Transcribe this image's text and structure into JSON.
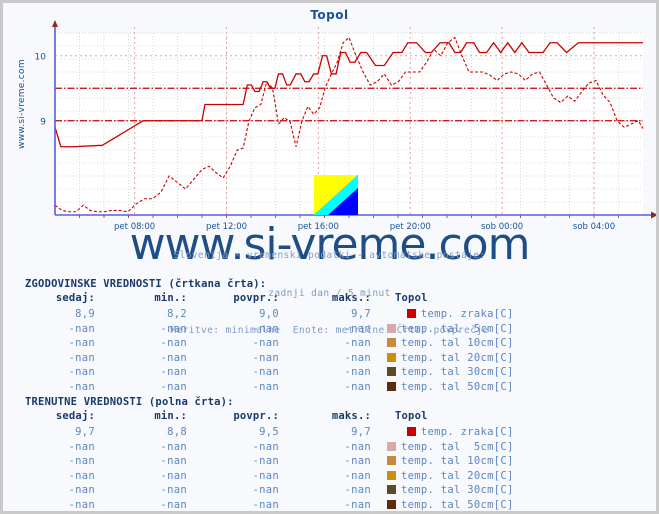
{
  "page": {
    "background": "#f7f9fd",
    "border_color": "#c9c9c9"
  },
  "chart": {
    "title": "Topol",
    "y_axis_caption": "www.si-vreme.com",
    "watermark": "www.si-vreme.com",
    "caption_line1": "Slovenija - vremenski podatki - avtomatske postaje:",
    "caption_line2": "zadnji dan / 5 minut",
    "caption_line3": "Meritve: minimalne  Enote: metrične  Črta: povprečje",
    "accent_color": "#cc0000",
    "label_color": "#1a5296",
    "axis_color": "#5b5be0",
    "grid_color": "#d9d9d9",
    "grid_accent_color": "#e8a0a0"
  },
  "chart_data": {
    "type": "line",
    "title": "Topol",
    "xlabel": "",
    "ylabel": "temp. zraka[C]",
    "ylim": [
      7.55,
      10.35
    ],
    "yticks": [
      9,
      10
    ],
    "ytick_labels": [
      "9",
      "10"
    ],
    "grid": true,
    "legend_position": "below-table",
    "xticks": [
      "pet 08:00",
      "pet 12:00",
      "pet 16:00",
      "pet 20:00",
      "sob 00:00",
      "sob 04:00"
    ],
    "xtick_positions": [
      0.1354,
      0.2917,
      0.4479,
      0.6042,
      0.7604,
      0.9167
    ],
    "x_range_hours": 25.6,
    "reference_lines": [
      {
        "name": "avg-current",
        "value": 9.5,
        "style": "dash-dot",
        "color": "#cc0000"
      },
      {
        "name": "avg-history",
        "value": 9.0,
        "style": "dash-dot",
        "color": "#cc0000"
      }
    ],
    "series": [
      {
        "name": "temp. zraka[C] - trenutne (polna črta)",
        "style": "solid",
        "color": "#cc0000",
        "x": [
          0.0,
          0.01,
          0.018,
          0.03,
          0.075,
          0.08,
          0.15,
          0.155,
          0.25,
          0.255,
          0.32,
          0.327,
          0.334,
          0.34,
          0.347,
          0.354,
          0.36,
          0.367,
          0.374,
          0.38,
          0.387,
          0.394,
          0.4,
          0.41,
          0.418,
          0.425,
          0.432,
          0.44,
          0.447,
          0.455,
          0.462,
          0.47,
          0.478,
          0.486,
          0.494,
          0.502,
          0.51,
          0.52,
          0.53,
          0.545,
          0.56,
          0.575,
          0.59,
          0.6,
          0.615,
          0.63,
          0.64,
          0.655,
          0.67,
          0.68,
          0.69,
          0.7,
          0.712,
          0.722,
          0.734,
          0.746,
          0.758,
          0.77,
          0.782,
          0.794,
          0.806,
          0.818,
          0.83,
          0.842,
          0.854,
          0.87,
          0.89,
          0.92,
          0.96,
          1.0
        ],
        "y": [
          8.9,
          8.6,
          8.6,
          8.6,
          8.62,
          8.62,
          9.0,
          9.0,
          9.0,
          9.25,
          9.25,
          9.55,
          9.55,
          9.45,
          9.45,
          9.6,
          9.6,
          9.5,
          9.5,
          9.72,
          9.72,
          9.55,
          9.55,
          9.72,
          9.72,
          9.6,
          9.6,
          9.72,
          9.72,
          10.0,
          10.0,
          9.72,
          9.72,
          10.05,
          10.05,
          9.9,
          9.9,
          10.05,
          10.05,
          9.85,
          9.85,
          10.05,
          10.05,
          10.2,
          10.2,
          10.05,
          10.05,
          10.2,
          10.2,
          10.05,
          10.05,
          10.2,
          10.2,
          10.05,
          10.05,
          10.2,
          10.05,
          10.2,
          10.05,
          10.2,
          10.05,
          10.05,
          10.05,
          10.2,
          10.2,
          10.05,
          10.2,
          10.2,
          10.2,
          10.2
        ]
      },
      {
        "name": "temp. zraka[C] - zgodovinske (črtkana črta)",
        "style": "dashed",
        "color": "#cc0000",
        "x": [
          0.0,
          0.012,
          0.024,
          0.036,
          0.048,
          0.06,
          0.072,
          0.084,
          0.096,
          0.11,
          0.124,
          0.138,
          0.152,
          0.166,
          0.18,
          0.194,
          0.208,
          0.222,
          0.236,
          0.25,
          0.262,
          0.274,
          0.286,
          0.298,
          0.31,
          0.32,
          0.33,
          0.34,
          0.35,
          0.36,
          0.37,
          0.38,
          0.39,
          0.4,
          0.41,
          0.42,
          0.43,
          0.44,
          0.45,
          0.46,
          0.47,
          0.48,
          0.49,
          0.5,
          0.512,
          0.524,
          0.536,
          0.548,
          0.56,
          0.572,
          0.584,
          0.596,
          0.608,
          0.62,
          0.632,
          0.644,
          0.656,
          0.668,
          0.68,
          0.692,
          0.704,
          0.716,
          0.728,
          0.74,
          0.752,
          0.764,
          0.776,
          0.788,
          0.8,
          0.812,
          0.824,
          0.836,
          0.848,
          0.86,
          0.872,
          0.884,
          0.896,
          0.908,
          0.92,
          0.932,
          0.944,
          0.956,
          0.968,
          0.98,
          0.992,
          1.0
        ],
        "y": [
          7.7,
          7.62,
          7.6,
          7.6,
          7.7,
          7.62,
          7.6,
          7.6,
          7.62,
          7.62,
          7.6,
          7.72,
          7.8,
          7.8,
          7.9,
          8.15,
          8.05,
          7.95,
          8.1,
          8.25,
          8.3,
          8.2,
          8.12,
          8.3,
          8.55,
          8.58,
          9.0,
          9.2,
          9.25,
          9.6,
          9.5,
          8.95,
          9.05,
          8.98,
          8.6,
          9.0,
          9.22,
          9.1,
          9.2,
          9.52,
          9.72,
          9.9,
          10.2,
          10.28,
          10.0,
          9.75,
          9.55,
          9.6,
          9.72,
          9.55,
          9.6,
          9.75,
          9.75,
          9.75,
          9.9,
          10.1,
          10.0,
          10.2,
          10.28,
          10.0,
          9.75,
          9.75,
          9.75,
          9.7,
          9.62,
          9.72,
          9.75,
          9.72,
          9.62,
          9.72,
          9.75,
          9.55,
          9.35,
          9.28,
          9.38,
          9.3,
          9.45,
          9.58,
          9.62,
          9.4,
          9.28,
          9.0,
          8.9,
          8.95,
          9.0,
          8.88
        ]
      }
    ]
  },
  "flag_logo": {
    "name": "si-vreme-flag-logo",
    "colors": [
      "#ffff00",
      "#00ffff",
      "#0000ff"
    ]
  },
  "tables": [
    {
      "id": "hist",
      "title": "ZGODOVINSKE VREDNOSTI (črtkana črta):",
      "headers": [
        "sedaj:",
        "min.:",
        "povpr.:",
        "maks.:",
        "Topol"
      ],
      "rows": [
        {
          "sedaj": "8,9",
          "min": "8,2",
          "povpr": "9,0",
          "maks": "9,7",
          "label": "temp. zraka[C]",
          "color": "#cc0000",
          "swatch_style": "dashed"
        },
        {
          "sedaj": "-nan",
          "min": "-nan",
          "povpr": "-nan",
          "maks": "-nan",
          "label": "temp. tal  5cm[C]",
          "color": "#d8a9a9",
          "swatch_style": "dashed"
        },
        {
          "sedaj": "-nan",
          "min": "-nan",
          "povpr": "-nan",
          "maks": "-nan",
          "label": "temp. tal 10cm[C]",
          "color": "#c88a3c",
          "swatch_style": "dashed"
        },
        {
          "sedaj": "-nan",
          "min": "-nan",
          "povpr": "-nan",
          "maks": "-nan",
          "label": "temp. tal 20cm[C]",
          "color": "#c8900c",
          "swatch_style": "dashed"
        },
        {
          "sedaj": "-nan",
          "min": "-nan",
          "povpr": "-nan",
          "maks": "-nan",
          "label": "temp. tal 30cm[C]",
          "color": "#5b4b28",
          "swatch_style": "dashed"
        },
        {
          "sedaj": "-nan",
          "min": "-nan",
          "povpr": "-nan",
          "maks": "-nan",
          "label": "temp. tal 50cm[C]",
          "color": "#5c2d0c",
          "swatch_style": "dashed"
        }
      ]
    },
    {
      "id": "curr",
      "title": "TRENUTNE VREDNOSTI (polna črta):",
      "headers": [
        "sedaj:",
        "min.:",
        "povpr.:",
        "maks.:",
        "Topol"
      ],
      "rows": [
        {
          "sedaj": "9,7",
          "min": "8,8",
          "povpr": "9,5",
          "maks": "9,7",
          "label": "temp. zraka[C]",
          "color": "#cc0000",
          "swatch_style": "solid"
        },
        {
          "sedaj": "-nan",
          "min": "-nan",
          "povpr": "-nan",
          "maks": "-nan",
          "label": "temp. tal  5cm[C]",
          "color": "#d8a9a9",
          "swatch_style": "solid"
        },
        {
          "sedaj": "-nan",
          "min": "-nan",
          "povpr": "-nan",
          "maks": "-nan",
          "label": "temp. tal 10cm[C]",
          "color": "#c88a3c",
          "swatch_style": "solid"
        },
        {
          "sedaj": "-nan",
          "min": "-nan",
          "povpr": "-nan",
          "maks": "-nan",
          "label": "temp. tal 20cm[C]",
          "color": "#c8900c",
          "swatch_style": "solid"
        },
        {
          "sedaj": "-nan",
          "min": "-nan",
          "povpr": "-nan",
          "maks": "-nan",
          "label": "temp. tal 30cm[C]",
          "color": "#5b4b28",
          "swatch_style": "solid"
        },
        {
          "sedaj": "-nan",
          "min": "-nan",
          "povpr": "-nan",
          "maks": "-nan",
          "label": "temp. tal 50cm[C]",
          "color": "#5c2d0c",
          "swatch_style": "solid"
        }
      ]
    }
  ]
}
